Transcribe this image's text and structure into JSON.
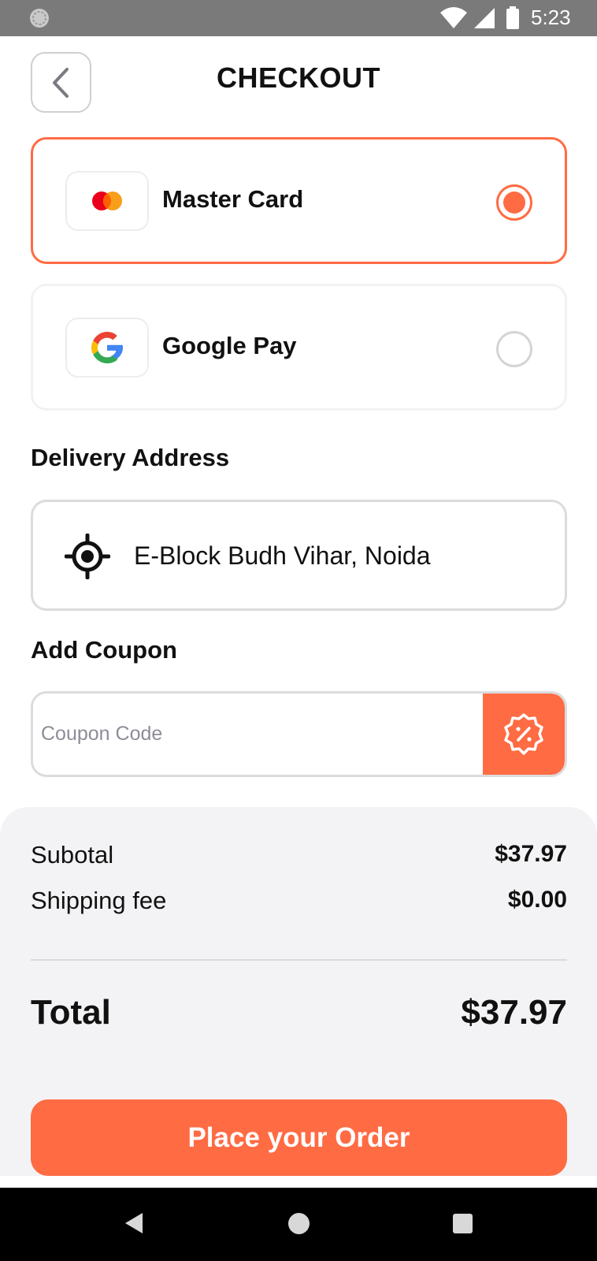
{
  "status_bar": {
    "time": "5:23",
    "icons": [
      "app-notification-icon",
      "wifi-icon",
      "signal-icon",
      "battery-icon"
    ],
    "background": "#7a7a7a"
  },
  "header": {
    "title": "CHECKOUT",
    "back_icon": "chevron-left-icon"
  },
  "payment_methods": [
    {
      "label": "Master Card",
      "icon": "mastercard-icon",
      "selected": true
    },
    {
      "label": "Google Pay",
      "icon": "google-icon",
      "selected": false
    }
  ],
  "delivery": {
    "title": "Delivery Address",
    "address": "E-Block Budh Vihar, Noida",
    "icon": "location-target-icon"
  },
  "coupon": {
    "title": "Add Coupon",
    "placeholder": "Coupon Code",
    "value": "",
    "apply_icon": "discount-badge-icon"
  },
  "summary": {
    "subtotal_label": "Subotal",
    "subtotal_value": "$37.97",
    "shipping_label": "Shipping fee",
    "shipping_value": "$0.00",
    "total_label": "Total",
    "total_value": "$37.97"
  },
  "order_button": {
    "label": "Place your Order"
  },
  "colors": {
    "accent": "#ff6b43",
    "panel": "#f3f3f5",
    "text": "#111111"
  },
  "nav_bar": {
    "icons": [
      "nav-back-icon",
      "nav-home-icon",
      "nav-recents-icon"
    ]
  }
}
